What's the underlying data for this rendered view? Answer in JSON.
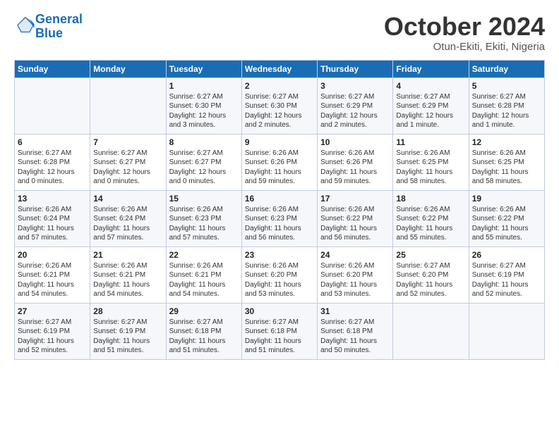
{
  "header": {
    "logo_general": "General",
    "logo_blue": "Blue",
    "month_title": "October 2024",
    "location": "Otun-Ekiti, Ekiti, Nigeria"
  },
  "weekdays": [
    "Sunday",
    "Monday",
    "Tuesday",
    "Wednesday",
    "Thursday",
    "Friday",
    "Saturday"
  ],
  "weeks": [
    [
      {
        "day": "",
        "info": ""
      },
      {
        "day": "",
        "info": ""
      },
      {
        "day": "1",
        "info": "Sunrise: 6:27 AM\nSunset: 6:30 PM\nDaylight: 12 hours\nand 3 minutes."
      },
      {
        "day": "2",
        "info": "Sunrise: 6:27 AM\nSunset: 6:30 PM\nDaylight: 12 hours\nand 2 minutes."
      },
      {
        "day": "3",
        "info": "Sunrise: 6:27 AM\nSunset: 6:29 PM\nDaylight: 12 hours\nand 2 minutes."
      },
      {
        "day": "4",
        "info": "Sunrise: 6:27 AM\nSunset: 6:29 PM\nDaylight: 12 hours\nand 1 minute."
      },
      {
        "day": "5",
        "info": "Sunrise: 6:27 AM\nSunset: 6:28 PM\nDaylight: 12 hours\nand 1 minute."
      }
    ],
    [
      {
        "day": "6",
        "info": "Sunrise: 6:27 AM\nSunset: 6:28 PM\nDaylight: 12 hours\nand 0 minutes."
      },
      {
        "day": "7",
        "info": "Sunrise: 6:27 AM\nSunset: 6:27 PM\nDaylight: 12 hours\nand 0 minutes."
      },
      {
        "day": "8",
        "info": "Sunrise: 6:27 AM\nSunset: 6:27 PM\nDaylight: 12 hours\nand 0 minutes."
      },
      {
        "day": "9",
        "info": "Sunrise: 6:26 AM\nSunset: 6:26 PM\nDaylight: 11 hours\nand 59 minutes."
      },
      {
        "day": "10",
        "info": "Sunrise: 6:26 AM\nSunset: 6:26 PM\nDaylight: 11 hours\nand 59 minutes."
      },
      {
        "day": "11",
        "info": "Sunrise: 6:26 AM\nSunset: 6:25 PM\nDaylight: 11 hours\nand 58 minutes."
      },
      {
        "day": "12",
        "info": "Sunrise: 6:26 AM\nSunset: 6:25 PM\nDaylight: 11 hours\nand 58 minutes."
      }
    ],
    [
      {
        "day": "13",
        "info": "Sunrise: 6:26 AM\nSunset: 6:24 PM\nDaylight: 11 hours\nand 57 minutes."
      },
      {
        "day": "14",
        "info": "Sunrise: 6:26 AM\nSunset: 6:24 PM\nDaylight: 11 hours\nand 57 minutes."
      },
      {
        "day": "15",
        "info": "Sunrise: 6:26 AM\nSunset: 6:23 PM\nDaylight: 11 hours\nand 57 minutes."
      },
      {
        "day": "16",
        "info": "Sunrise: 6:26 AM\nSunset: 6:23 PM\nDaylight: 11 hours\nand 56 minutes."
      },
      {
        "day": "17",
        "info": "Sunrise: 6:26 AM\nSunset: 6:22 PM\nDaylight: 11 hours\nand 56 minutes."
      },
      {
        "day": "18",
        "info": "Sunrise: 6:26 AM\nSunset: 6:22 PM\nDaylight: 11 hours\nand 55 minutes."
      },
      {
        "day": "19",
        "info": "Sunrise: 6:26 AM\nSunset: 6:22 PM\nDaylight: 11 hours\nand 55 minutes."
      }
    ],
    [
      {
        "day": "20",
        "info": "Sunrise: 6:26 AM\nSunset: 6:21 PM\nDaylight: 11 hours\nand 54 minutes."
      },
      {
        "day": "21",
        "info": "Sunrise: 6:26 AM\nSunset: 6:21 PM\nDaylight: 11 hours\nand 54 minutes."
      },
      {
        "day": "22",
        "info": "Sunrise: 6:26 AM\nSunset: 6:21 PM\nDaylight: 11 hours\nand 54 minutes."
      },
      {
        "day": "23",
        "info": "Sunrise: 6:26 AM\nSunset: 6:20 PM\nDaylight: 11 hours\nand 53 minutes."
      },
      {
        "day": "24",
        "info": "Sunrise: 6:26 AM\nSunset: 6:20 PM\nDaylight: 11 hours\nand 53 minutes."
      },
      {
        "day": "25",
        "info": "Sunrise: 6:27 AM\nSunset: 6:20 PM\nDaylight: 11 hours\nand 52 minutes."
      },
      {
        "day": "26",
        "info": "Sunrise: 6:27 AM\nSunset: 6:19 PM\nDaylight: 11 hours\nand 52 minutes."
      }
    ],
    [
      {
        "day": "27",
        "info": "Sunrise: 6:27 AM\nSunset: 6:19 PM\nDaylight: 11 hours\nand 52 minutes."
      },
      {
        "day": "28",
        "info": "Sunrise: 6:27 AM\nSunset: 6:19 PM\nDaylight: 11 hours\nand 51 minutes."
      },
      {
        "day": "29",
        "info": "Sunrise: 6:27 AM\nSunset: 6:18 PM\nDaylight: 11 hours\nand 51 minutes."
      },
      {
        "day": "30",
        "info": "Sunrise: 6:27 AM\nSunset: 6:18 PM\nDaylight: 11 hours\nand 51 minutes."
      },
      {
        "day": "31",
        "info": "Sunrise: 6:27 AM\nSunset: 6:18 PM\nDaylight: 11 hours\nand 50 minutes."
      },
      {
        "day": "",
        "info": ""
      },
      {
        "day": "",
        "info": ""
      }
    ]
  ]
}
